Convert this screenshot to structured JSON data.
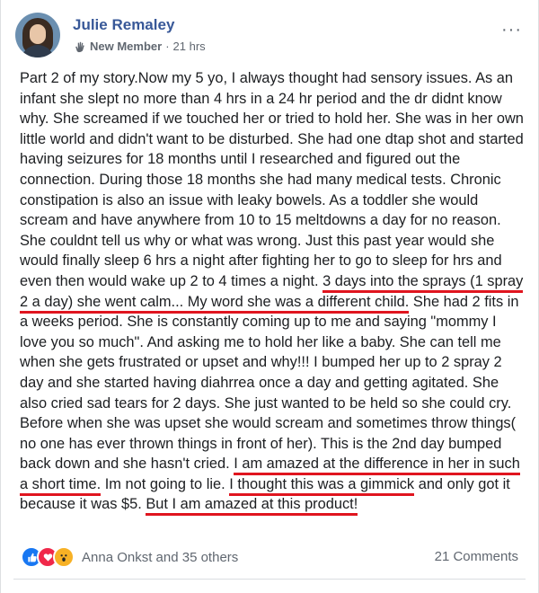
{
  "post": {
    "author_name": "Julie Remaley",
    "badge": "New Member",
    "separator": "·",
    "time": "21 hrs",
    "more_label": "···"
  },
  "body": {
    "text1": "Part 2 of my story.Now my 5 yo, I always thought had sensory issues. As an infant she slept no more than 4 hrs in a 24 hr period and the dr didnt know why. She screamed if we touched her or tried to hold her. She was in her own little world and didn't want to be disturbed. She had one dtap shot and started having seizures for 18 months until I researched and figured out the connection. During those 18 months she had many medical tests. Chronic constipation is also an issue with leaky bowels. As a toddler she would scream and have anywhere from 10 to 15 meltdowns a day for no reason. She couldnt tell us why or what was wrong. Just this past year would she would finally sleep 6 hrs a night after fighting her to go to sleep for hrs and even then would wake up 2 to 4 times a night.",
    "hl1": "3 days into the sprays (1 spray 2 a day) she went calm... My word she was a different child.",
    "text2": "She had 2 fits in a weeks period. She is constantly coming up to me and saying \"mommy I love you so much\". And asking me to hold her like a baby. She can tell me when she gets frustrated or upset and why!!! I bumped her up to 2 spray 2 day and she started having diahrrea once a day and getting agitated. She also cried sad tears for 2 days. She just wanted to be held so she could cry. Before when she was upset she would scream and sometimes throw things( no one has ever thrown things in front of her). This is the 2nd day bumped back down and she hasn't cried.",
    "hl2": "I am amazed at the difference in her in such a short time.",
    "text3": "Im not going to lie.",
    "hl3": "I thought this was a gimmick",
    "text4": "and only got it because it was $5.",
    "hl4": "But I am amazed at this product!"
  },
  "footer": {
    "reactions": [
      "like-icon",
      "love-icon",
      "wow-icon"
    ],
    "reactors": "Anna Onkst and 35 others",
    "comments": "21 Comments"
  },
  "colors": {
    "link": "#385898",
    "underline": "#e0151f",
    "muted": "#606770"
  }
}
